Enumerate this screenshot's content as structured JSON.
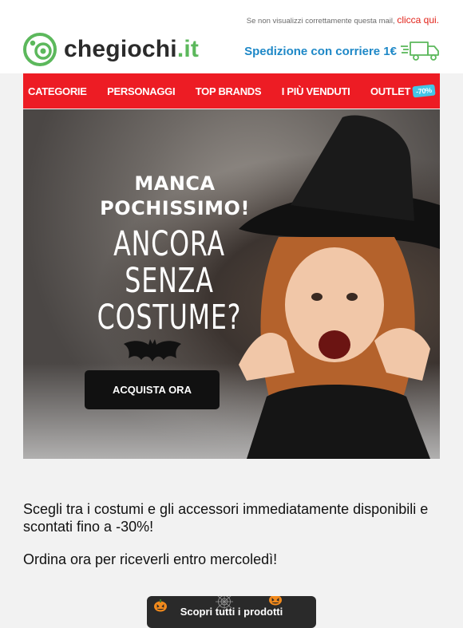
{
  "preheader": {
    "text": "Se non visualizzi correttamente questa mail,",
    "link": "clicca qui."
  },
  "logo": {
    "name": "chegiochi",
    "tld": ".it"
  },
  "shipping": {
    "text": "Spedizione con corriere 1€"
  },
  "nav": {
    "items": [
      {
        "label": "CATEGORIE"
      },
      {
        "label": "PERSONAGGI"
      },
      {
        "label": "TOP BRANDS"
      },
      {
        "label": "I PIÙ VENDUTI"
      },
      {
        "label": "OUTLET",
        "badge": "-70%"
      }
    ]
  },
  "hero": {
    "kicker": "MANCA POCHISSIMO!",
    "title": "ANCORA SENZA COSTUME?",
    "cta": "ACQUISTA ORA"
  },
  "body": {
    "paragraph1": "Scegli tra i costumi e gli accessori immediatamente disponibili e scontati fino a -30%!",
    "paragraph2": "Ordina ora per riceverli entro mercoledì!"
  },
  "bottom_cta": {
    "label": "Scopri tutti i prodotti"
  },
  "colors": {
    "brand_green": "#5cb85c",
    "nav_red": "#ed1c24",
    "shipping_blue": "#1e88c7",
    "link_red": "#e2231a"
  },
  "icons": [
    "logo-icon",
    "truck-icon",
    "bat-icon",
    "pumpkin-icon",
    "spiderweb-icon"
  ]
}
